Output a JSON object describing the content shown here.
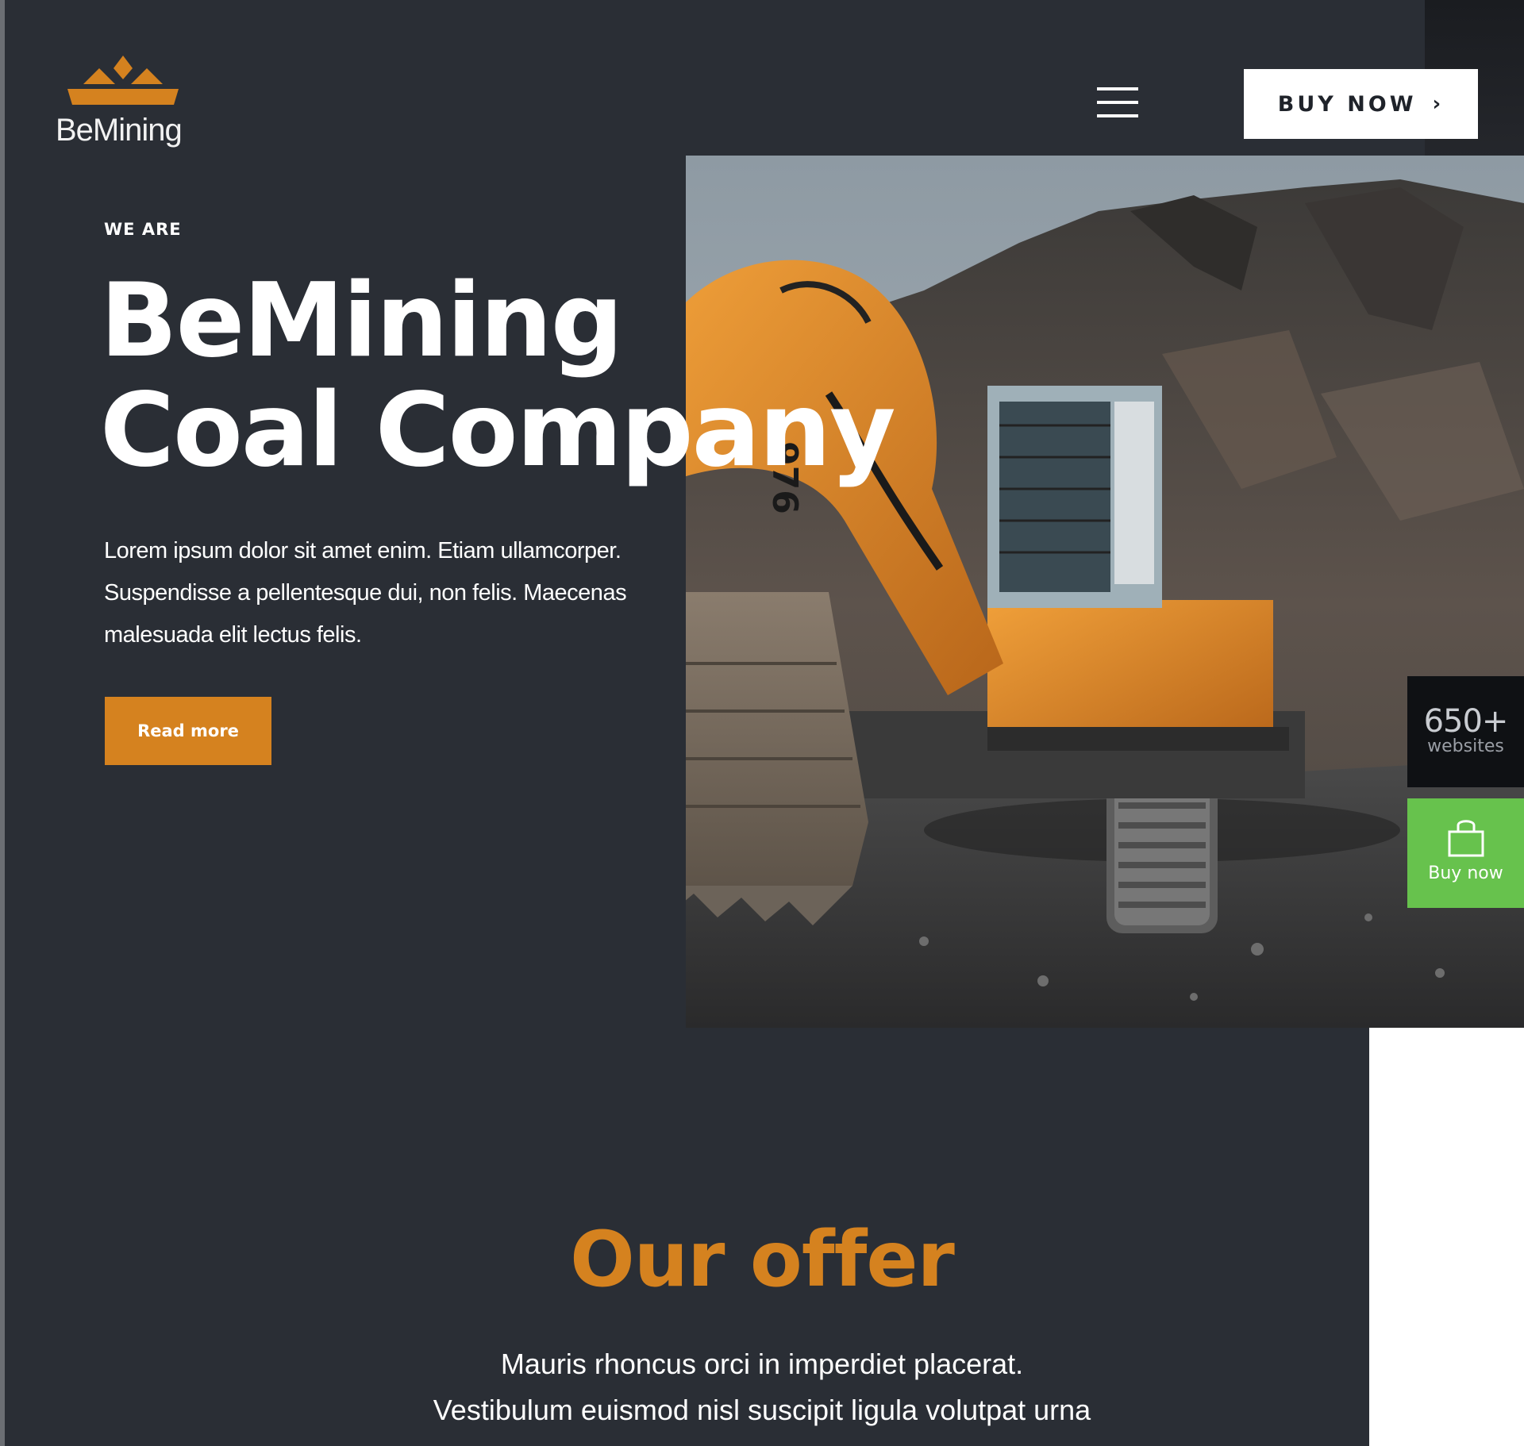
{
  "brand": {
    "name": "BeMining",
    "accent_color": "#d5821f",
    "background_color": "#2a2e35",
    "logo_icon": "mountain-crown-logo-icon"
  },
  "header": {
    "menu_icon": "hamburger-menu-icon",
    "buy_now_label": "BUY NOW",
    "buy_now_icon": "chevron-right-icon"
  },
  "hero": {
    "eyebrow": "WE ARE",
    "title_line1": "BeMining",
    "title_line2": "Coal Company",
    "body_line1": "Lorem ipsum dolor sit amet enim. Etiam ullamcorper.",
    "body_line2": "Suspendisse a pellentesque dui, non felis. Maecenas",
    "body_line3": "malesuada elit lectus felis.",
    "read_more_label": "Read more",
    "image": "excavator-in-quarry-photo"
  },
  "side_widgets": {
    "count_value": "650+",
    "count_label": "websites",
    "buy_label": "Buy now",
    "buy_icon": "shopping-bag-icon",
    "buy_color": "#67c24d"
  },
  "offer": {
    "title": "Our offer",
    "body_line1": "Mauris rhoncus orci in imperdiet placerat.",
    "body_line2": "Vestibulum euismod nisl suscipit ligula volutpat urna"
  }
}
